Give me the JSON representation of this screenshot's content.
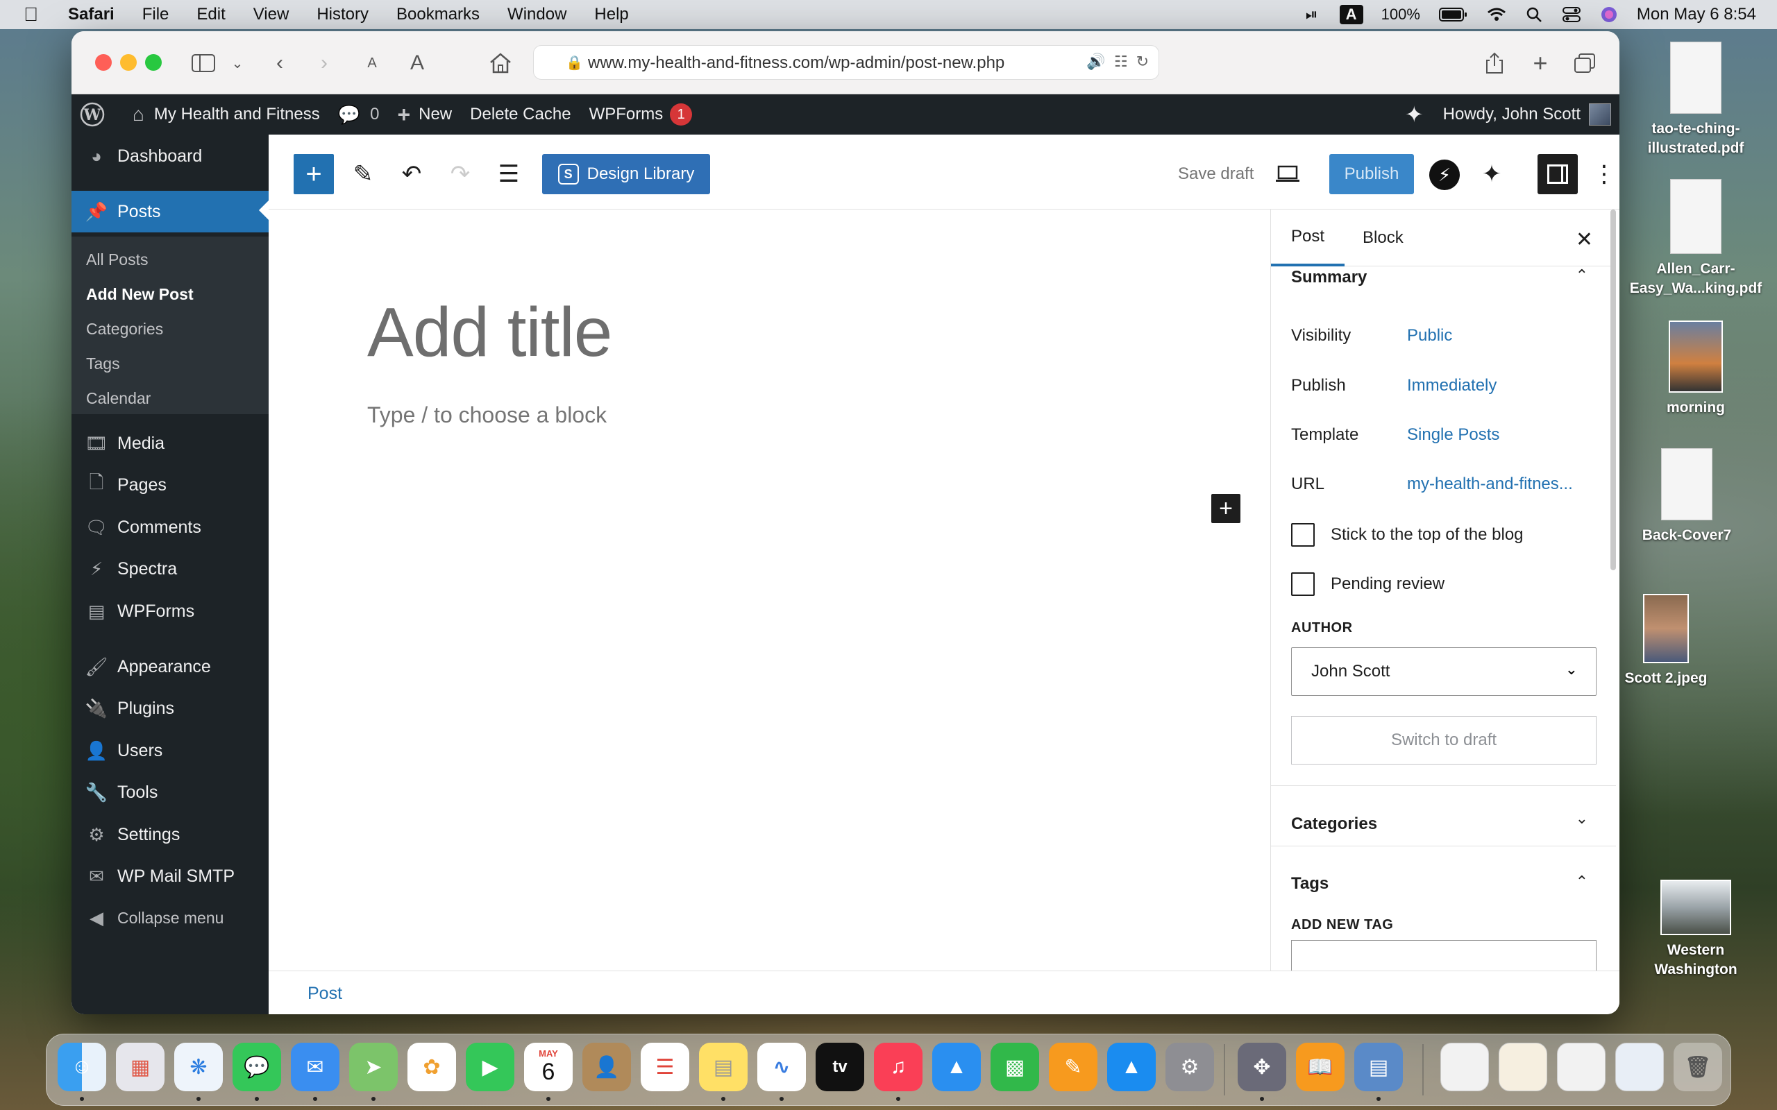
{
  "menubar": {
    "app": "Safari",
    "items": [
      "File",
      "Edit",
      "View",
      "History",
      "Bookmarks",
      "Window",
      "Help"
    ],
    "battery": "100%",
    "input_source": "A",
    "clock": "Mon May 6  8:54"
  },
  "browser": {
    "url": "www.my-health-and-fitness.com/wp-admin/post-new.php",
    "text_small": "A",
    "text_large": "A"
  },
  "adminbar": {
    "site_name": "My Health and Fitness",
    "comments_count": "0",
    "new_label": "New",
    "delete_cache": "Delete Cache",
    "wpforms": "WPForms",
    "wpforms_badge": "1",
    "howdy": "Howdy, John Scott"
  },
  "sidebar": {
    "dashboard": "Dashboard",
    "posts": "Posts",
    "submenu": [
      "All Posts",
      "Add New Post",
      "Categories",
      "Tags",
      "Calendar"
    ],
    "media": "Media",
    "pages": "Pages",
    "comments": "Comments",
    "spectra": "Spectra",
    "wpforms": "WPForms",
    "appearance": "Appearance",
    "plugins": "Plugins",
    "users": "Users",
    "tools": "Tools",
    "settings": "Settings",
    "wp_mail_smtp": "WP Mail SMTP",
    "collapse": "Collapse menu"
  },
  "editor": {
    "design_library": "Design Library",
    "save_draft": "Save draft",
    "publish": "Publish",
    "title_placeholder": "Add title",
    "block_placeholder": "Type / to choose a block",
    "breadcrumb": "Post"
  },
  "panel": {
    "tab_post": "Post",
    "tab_block": "Block",
    "summary": "Summary",
    "visibility_label": "Visibility",
    "visibility_value": "Public",
    "publish_label": "Publish",
    "publish_value": "Immediately",
    "template_label": "Template",
    "template_value": "Single Posts",
    "url_label": "URL",
    "url_value": "my-health-and-fitnes...",
    "sticky": "Stick to the top of the blog",
    "pending": "Pending review",
    "author_caption": "AUTHOR",
    "author_value": "John Scott",
    "switch_draft": "Switch to draft",
    "categories": "Categories",
    "tags": "Tags",
    "add_new_tag": "ADD NEW TAG"
  },
  "desktop": {
    "files": [
      {
        "label": "tao-te-ching-illustrated.pdf"
      },
      {
        "label": "Allen_Carr-Easy_Wa...king.pdf"
      },
      {
        "label": "morning"
      },
      {
        "label": "Back-Cover7"
      },
      {
        "label": "Scott 2.jpeg"
      },
      {
        "label": "Western Washington"
      }
    ]
  },
  "dock": {
    "calendar_month": "MAY",
    "calendar_day": "6",
    "tv_label": "tv"
  },
  "colors": {
    "wp_blue": "#2271b1",
    "admin_dark": "#1d2327",
    "badge_red": "#d63638"
  }
}
